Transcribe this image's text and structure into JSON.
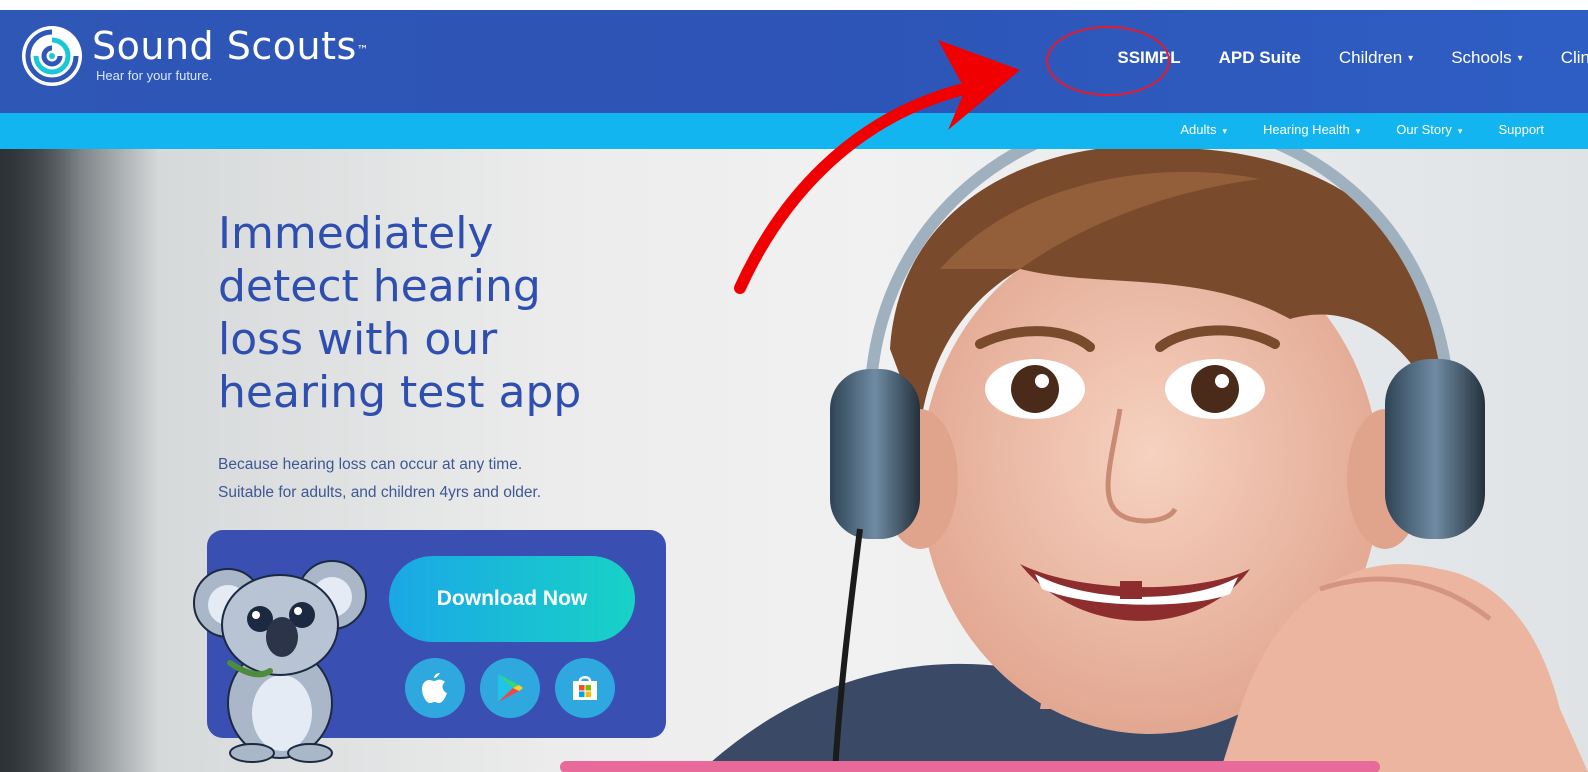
{
  "brand": {
    "name": "Sound Scouts",
    "trademark": "™",
    "tagline": "Hear for your future."
  },
  "nav": {
    "main": [
      {
        "label": "SSIMPL",
        "bold": true,
        "dropdown": false
      },
      {
        "label": "APD Suite",
        "bold": true,
        "dropdown": false
      },
      {
        "label": "Children",
        "bold": false,
        "dropdown": true
      },
      {
        "label": "Schools",
        "bold": false,
        "dropdown": true
      },
      {
        "label": "Clin",
        "bold": false,
        "dropdown": false
      }
    ],
    "sub": [
      {
        "label": "Adults",
        "dropdown": true
      },
      {
        "label": "Hearing Health",
        "dropdown": true
      },
      {
        "label": "Our Story",
        "dropdown": true
      },
      {
        "label": "Support",
        "dropdown": false
      }
    ],
    "caret": "▾"
  },
  "hero": {
    "headline": [
      "Immediately",
      "detect hearing",
      "loss with our",
      "hearing test app"
    ],
    "subtext": [
      "Because hearing loss can occur at any time.",
      "Suitable for adults, and children 4yrs and older."
    ],
    "download_label": "Download Now",
    "stores": [
      "apple-icon",
      "google-play-icon",
      "microsoft-store-icon"
    ]
  },
  "annotation": {
    "circle_color": "#e8192c",
    "arrow_color": "#f00000",
    "highlighted_item": "SSIMPL"
  },
  "colors": {
    "header": "#2f57b6",
    "subbar": "#13b5f0",
    "headline": "#2f4fb0",
    "card": "#3a4fb2"
  }
}
